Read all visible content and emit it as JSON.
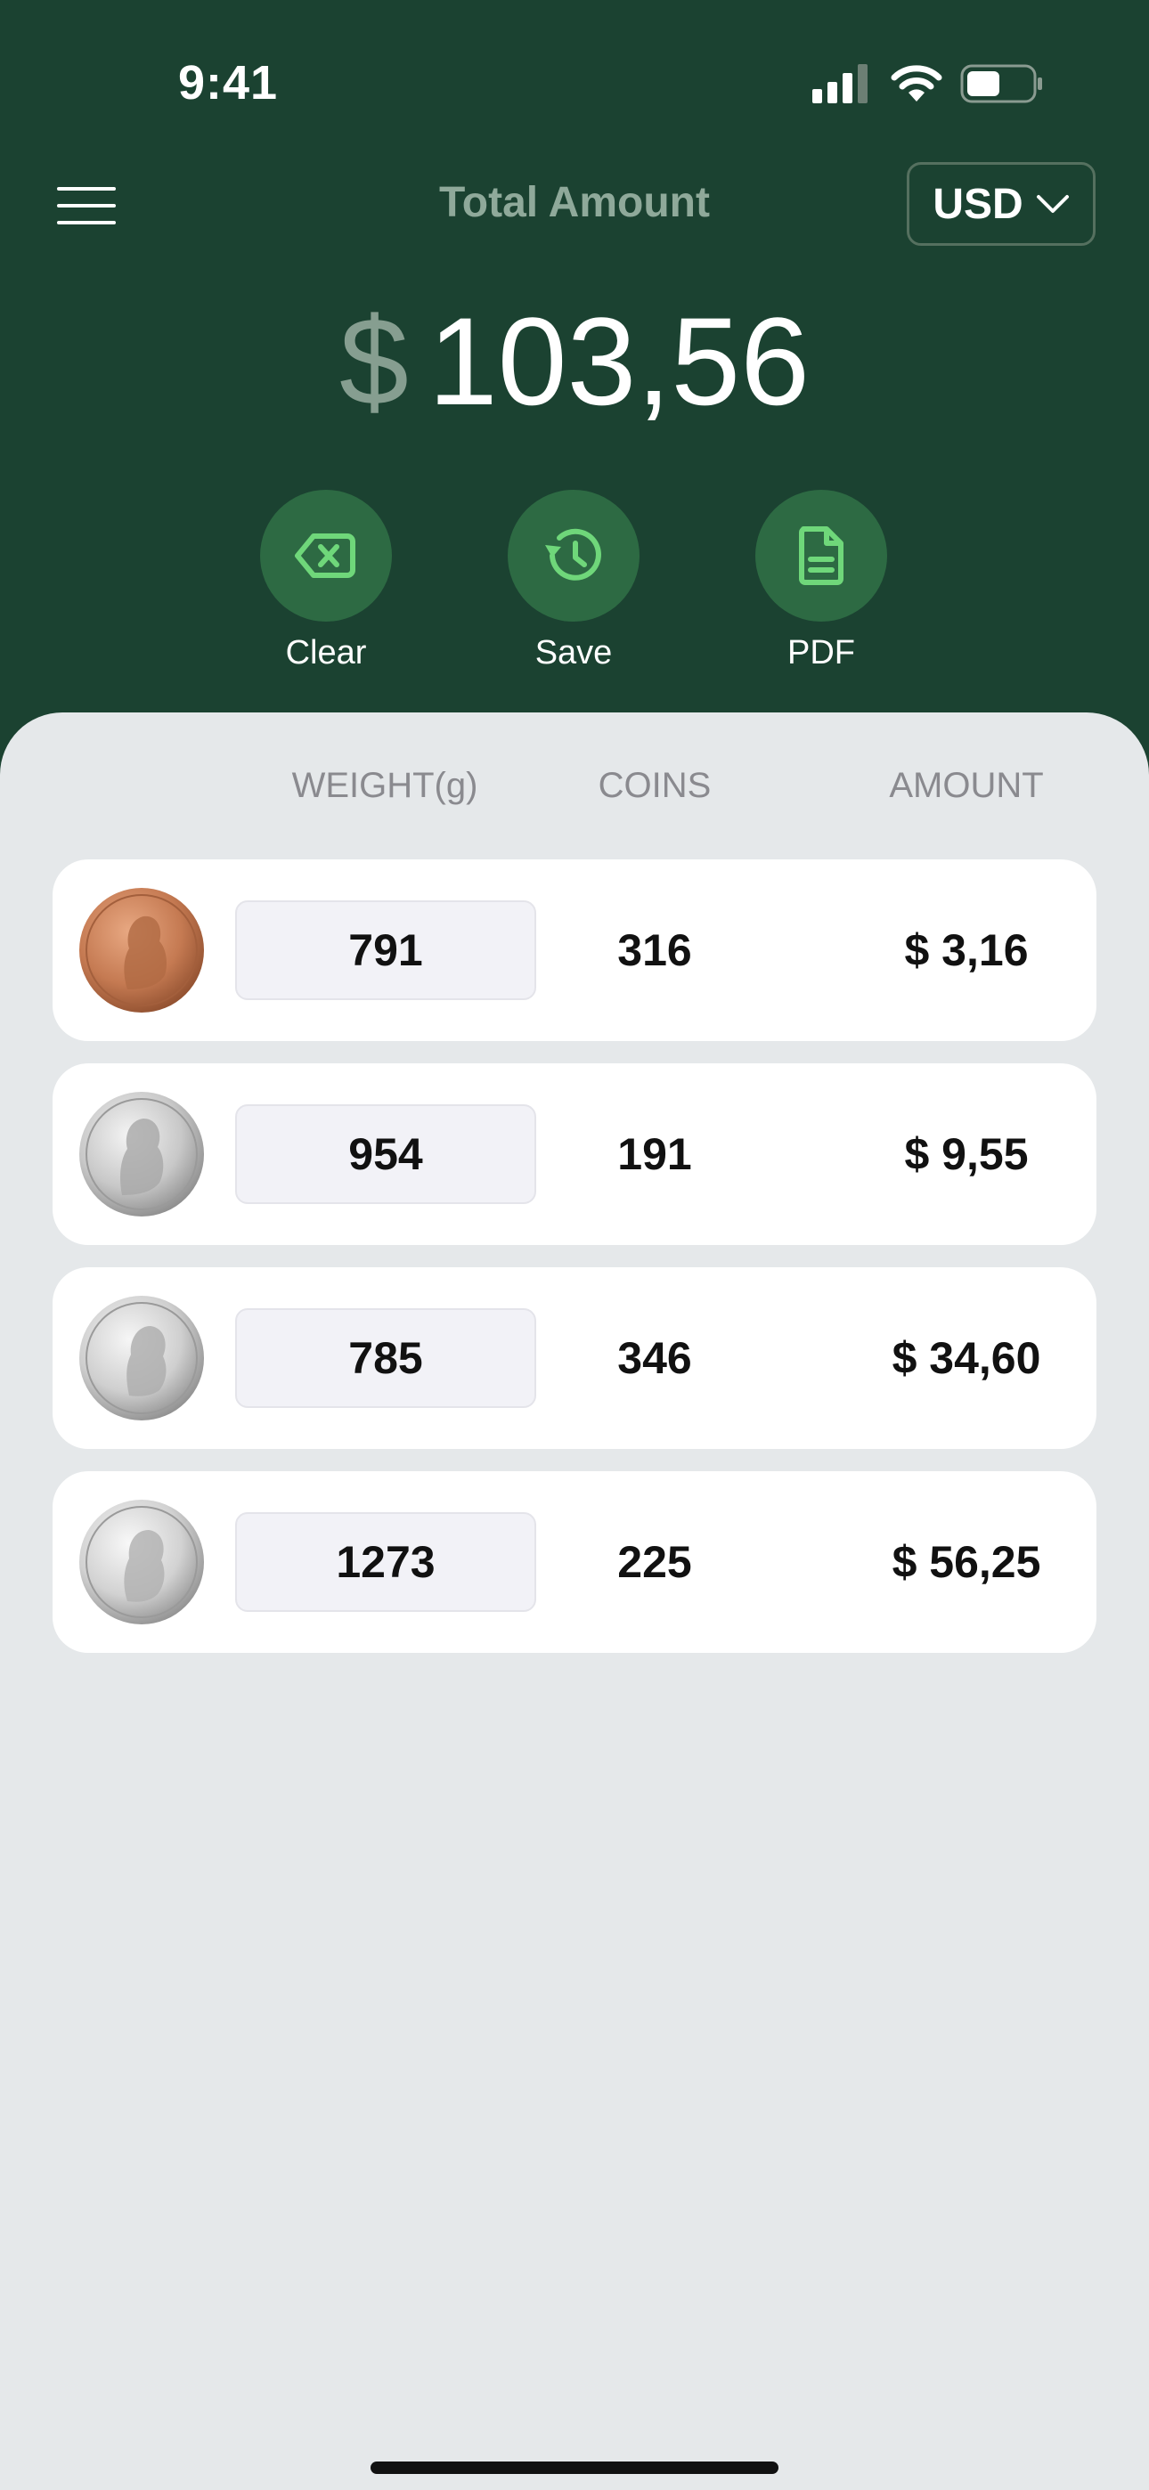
{
  "status_bar": {
    "time": "9:41",
    "icons": [
      "cellular-signal-icon",
      "wifi-icon",
      "battery-icon"
    ]
  },
  "header": {
    "menu_icon": "hamburger-menu-icon",
    "title": "Total Amount",
    "currency": "USD",
    "currency_icon": "chevron-down-icon"
  },
  "total": {
    "symbol": "$",
    "value": "103,56"
  },
  "actions": [
    {
      "label": "Clear",
      "icon": "backspace-icon"
    },
    {
      "label": "Save",
      "icon": "history-icon"
    },
    {
      "label": "PDF",
      "icon": "document-icon"
    }
  ],
  "table": {
    "headers": {
      "weight": "WEIGHT(g)",
      "coins": "COINS",
      "amount": "AMOUNT"
    },
    "rows": [
      {
        "coin": "penny",
        "weight": "791",
        "coins": "316",
        "amount": "$ 3,16"
      },
      {
        "coin": "nickel",
        "weight": "954",
        "coins": "191",
        "amount": "$ 9,55"
      },
      {
        "coin": "dime",
        "weight": "785",
        "coins": "346",
        "amount": "$ 34,60"
      },
      {
        "coin": "quarter",
        "weight": "1273",
        "coins": "225",
        "amount": "$ 56,25"
      }
    ]
  },
  "colors": {
    "header_bg": "#1b4231",
    "action_circle": "#2d6a43",
    "action_icon": "#6fd77a",
    "sheet_bg": "#e5e8ea",
    "penny": "#c57a52",
    "silver": "#c8c8c8"
  }
}
